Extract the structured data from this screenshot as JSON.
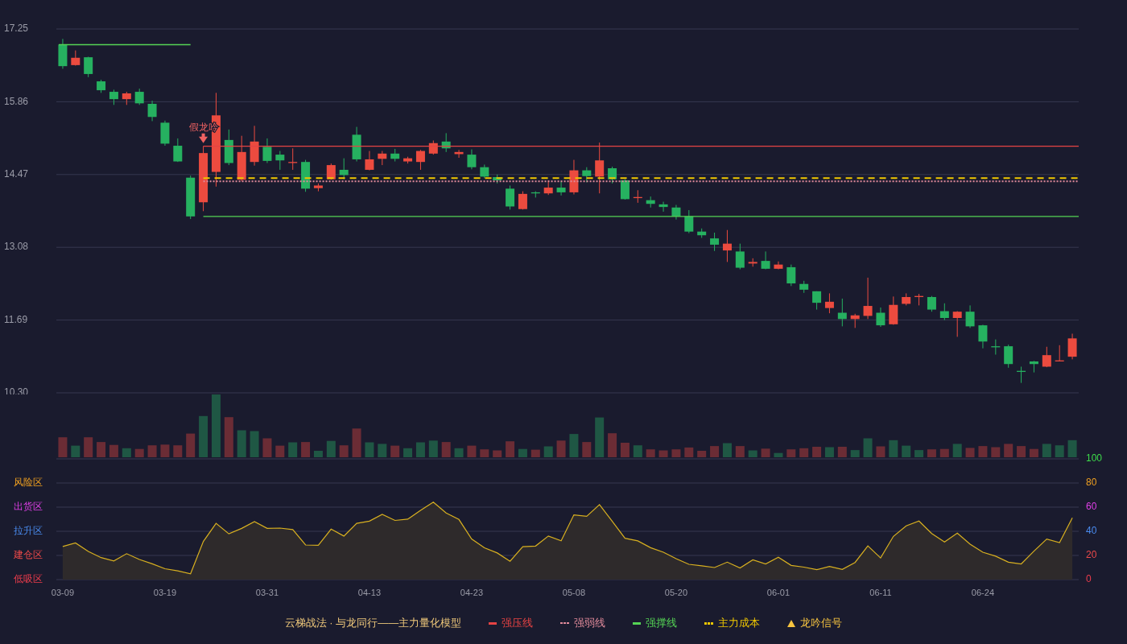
{
  "price_chart": {
    "chart_data": {
      "type": "candlestick",
      "categories": [
        null,
        null,
        null,
        null,
        null,
        null,
        null,
        null,
        null,
        null,
        null,
        null,
        null,
        null,
        null,
        null,
        null,
        null,
        null,
        null,
        null,
        null,
        null,
        null,
        null,
        null,
        null,
        null,
        null,
        null,
        null,
        null,
        null,
        null,
        null,
        null,
        null,
        null,
        null,
        null,
        null,
        null,
        null,
        null,
        null,
        null,
        null,
        null,
        null,
        null,
        null,
        null,
        null,
        null,
        null,
        null,
        null,
        null,
        null,
        null,
        null,
        null,
        null,
        null,
        null,
        null,
        null,
        null,
        null,
        null,
        null,
        null,
        null,
        null,
        null,
        null,
        null,
        null,
        null,
        null
      ],
      "ylim": [
        10.3,
        17.25
      ],
      "yticks": [
        17.25,
        15.86,
        14.47,
        13.08,
        11.69,
        {
          "value": 10.3,
          "label": "10.30"
        }
      ],
      "grid": true,
      "ohlc": [
        [
          16.95,
          17.06,
          16.49,
          16.54
        ],
        [
          16.56,
          16.84,
          16.55,
          16.7
        ],
        [
          16.71,
          16.72,
          16.33,
          16.39
        ],
        [
          16.25,
          16.28,
          16.03,
          16.08
        ],
        [
          16.05,
          16.09,
          15.8,
          15.91
        ],
        [
          15.91,
          16.05,
          15.8,
          16.02
        ],
        [
          16.05,
          16.11,
          15.8,
          15.83
        ],
        [
          15.82,
          15.88,
          15.49,
          15.57
        ],
        [
          15.46,
          15.5,
          15.02,
          15.06
        ],
        [
          15.02,
          15.16,
          14.71,
          14.72
        ],
        [
          14.41,
          14.45,
          13.62,
          13.67
        ],
        [
          13.94,
          15.01,
          13.77,
          14.88
        ],
        [
          14.52,
          16.03,
          14.24,
          15.6
        ],
        [
          15.13,
          15.33,
          14.65,
          14.69
        ],
        [
          14.37,
          15.21,
          14.34,
          14.9
        ],
        [
          14.71,
          15.4,
          14.64,
          15.1
        ],
        [
          15.0,
          15.16,
          14.69,
          14.73
        ],
        [
          14.85,
          14.92,
          14.56,
          14.74
        ],
        [
          14.69,
          14.97,
          14.56,
          14.71
        ],
        [
          14.71,
          14.75,
          14.14,
          14.2
        ],
        [
          14.21,
          14.3,
          14.15,
          14.26
        ],
        [
          14.38,
          14.68,
          14.37,
          14.65
        ],
        [
          14.56,
          14.78,
          14.38,
          14.46
        ],
        [
          15.23,
          15.38,
          14.72,
          14.76
        ],
        [
          14.56,
          14.92,
          14.55,
          14.76
        ],
        [
          14.77,
          14.92,
          14.65,
          14.87
        ],
        [
          14.87,
          14.96,
          14.72,
          14.77
        ],
        [
          14.72,
          14.81,
          14.68,
          14.78
        ],
        [
          14.71,
          14.94,
          14.56,
          14.92
        ],
        [
          14.87,
          15.12,
          14.85,
          15.07
        ],
        [
          15.1,
          15.26,
          14.9,
          14.97
        ],
        [
          14.86,
          14.94,
          14.79,
          14.9
        ],
        [
          14.85,
          14.95,
          14.57,
          14.61
        ],
        [
          14.61,
          14.66,
          14.4,
          14.43
        ],
        [
          14.42,
          14.47,
          14.3,
          14.36
        ],
        [
          14.2,
          14.26,
          13.8,
          13.86
        ],
        [
          13.81,
          14.15,
          13.8,
          14.1
        ],
        [
          14.13,
          14.15,
          14.03,
          14.11
        ],
        [
          14.11,
          14.36,
          14.08,
          14.22
        ],
        [
          14.22,
          14.35,
          14.07,
          14.13
        ],
        [
          14.13,
          14.75,
          14.09,
          14.55
        ],
        [
          14.55,
          14.61,
          14.32,
          14.44
        ],
        [
          14.43,
          15.08,
          14.11,
          14.74
        ],
        [
          14.59,
          14.62,
          14.3,
          14.38
        ],
        [
          14.36,
          14.38,
          13.99,
          14.0
        ],
        [
          14.02,
          14.17,
          13.93,
          14.04
        ],
        [
          13.98,
          14.05,
          13.84,
          13.91
        ],
        [
          13.9,
          13.95,
          13.76,
          13.85
        ],
        [
          13.84,
          13.89,
          13.61,
          13.67
        ],
        [
          13.67,
          13.79,
          13.35,
          13.38
        ],
        [
          13.38,
          13.44,
          13.26,
          13.31
        ],
        [
          13.25,
          13.36,
          13.01,
          13.13
        ],
        [
          13.02,
          13.41,
          12.8,
          13.15
        ],
        [
          13.0,
          13.15,
          12.66,
          12.69
        ],
        [
          12.77,
          12.87,
          12.71,
          12.8
        ],
        [
          12.82,
          13.0,
          12.66,
          12.67
        ],
        [
          12.67,
          12.81,
          12.66,
          12.75
        ],
        [
          12.7,
          12.75,
          12.34,
          12.39
        ],
        [
          12.38,
          12.44,
          12.21,
          12.27
        ],
        [
          12.24,
          12.24,
          11.89,
          12.02
        ],
        [
          11.92,
          12.2,
          11.82,
          12.04
        ],
        [
          11.83,
          12.1,
          11.57,
          11.71
        ],
        [
          11.71,
          11.81,
          11.54,
          11.78
        ],
        [
          11.77,
          12.5,
          11.71,
          11.96
        ],
        [
          11.83,
          11.93,
          11.56,
          11.59
        ],
        [
          11.61,
          12.14,
          11.6,
          11.98
        ],
        [
          12.0,
          12.2,
          11.97,
          12.13
        ],
        [
          12.13,
          12.19,
          11.97,
          12.15
        ],
        [
          12.13,
          12.15,
          11.85,
          11.89
        ],
        [
          11.86,
          12.01,
          11.69,
          11.73
        ],
        [
          11.73,
          11.86,
          11.37,
          11.85
        ],
        [
          11.85,
          11.97,
          11.54,
          11.57
        ],
        [
          11.59,
          11.6,
          11.15,
          11.28
        ],
        [
          11.19,
          11.32,
          11.03,
          11.17
        ],
        [
          11.19,
          11.22,
          10.78,
          10.85
        ],
        [
          10.72,
          10.8,
          10.49,
          10.7
        ],
        [
          10.9,
          10.91,
          10.69,
          10.85
        ],
        [
          10.8,
          11.18,
          10.79,
          11.02
        ],
        [
          10.9,
          11.21,
          10.9,
          10.92
        ],
        [
          10.99,
          11.43,
          10.94,
          11.34
        ]
      ],
      "ref_lines": [
        {
          "axis": "y",
          "value": 15.01,
          "label": "强压线",
          "color": "#e64343",
          "line_style": "solid"
        },
        {
          "axis": "y",
          "value": 14.34,
          "label": "强弱线",
          "color": "#e08a9a",
          "line_style": "dotted"
        },
        {
          "axis": "y",
          "value": 13.67,
          "label": "强撑线",
          "color": "#55d455",
          "line_style": "solid"
        },
        {
          "axis": "y",
          "value": 14.4,
          "label": "主力成本",
          "color": "#f0c800",
          "line_style": "dashed"
        },
        {
          "axis": "y",
          "value": 16.95,
          "color": "#55d455",
          "line_style": "solid"
        }
      ],
      "annotations": [
        "假龙吟"
      ]
    }
  },
  "oscillator": {
    "zones": [
      {
        "label": "风险区",
        "color": "#f0a020"
      },
      {
        "label": "出货区",
        "color": "#e040e8"
      },
      {
        "label": "拉升区",
        "color": "#4a8cf0"
      },
      {
        "label": "建仓区",
        "color": "#ee4a4a"
      },
      {
        "label": "低吸区",
        "color": "#ee3c4c"
      }
    ],
    "chart_data": {
      "type": "area",
      "categories": [
        "03-09",
        null,
        null,
        null,
        null,
        null,
        null,
        null,
        "03-19",
        null,
        null,
        null,
        null,
        null,
        null,
        null,
        "03-31",
        null,
        null,
        null,
        null,
        null,
        null,
        null,
        "04-13",
        null,
        null,
        null,
        null,
        null,
        null,
        null,
        "04-23",
        null,
        null,
        null,
        null,
        null,
        null,
        null,
        "05-08",
        null,
        null,
        null,
        null,
        null,
        null,
        null,
        "05-20",
        null,
        null,
        null,
        null,
        null,
        null,
        null,
        "06-01",
        null,
        null,
        null,
        null,
        null,
        null,
        null,
        "06-11",
        null,
        null,
        null,
        null,
        null,
        null,
        null,
        "06-24",
        null,
        null,
        null,
        null,
        null,
        null,
        null
      ],
      "ylim": [
        0,
        100
      ],
      "yticks": [
        100,
        80,
        60,
        40,
        20,
        0
      ],
      "grid": true,
      "series": [
        {
          "color": "#d8b020",
          "values": [
            27.5,
            30.4,
            23.3,
            18.2,
            15.5,
            21.5,
            16.7,
            13.1,
            9.0,
            7.2,
            4.8,
            31.6,
            46.6,
            37.9,
            42.4,
            48.1,
            42.4,
            42.7,
            41.5,
            28.7,
            28.4,
            41.8,
            36.1,
            46.6,
            48.4,
            54.0,
            49.0,
            50.1,
            57.3,
            64.2,
            55.2,
            49.8,
            33.7,
            26.3,
            22.1,
            15.2,
            27.2,
            27.8,
            36.1,
            32.2,
            53.6,
            52.4,
            62.1,
            48.2,
            34.2,
            32.1,
            26.4,
            22.7,
            17.3,
            12.7,
            11.5,
            10.0,
            14.5,
            9.7,
            16.4,
            13.0,
            18.5,
            11.8,
            10.3,
            8.2,
            10.9,
            8.5,
            14.2,
            27.9,
            17.9,
            35.8,
            44.5,
            48.5,
            38.2,
            31.2,
            38.5,
            29.4,
            22.7,
            19.4,
            14.5,
            13.0,
            23.6,
            33.6,
            30.6,
            51.2
          ]
        }
      ]
    }
  },
  "legend": {
    "title": "云梯战法 · 与龙同行——主力量化模型",
    "marker": {
      "label": "龙吟信号",
      "color": "#f7c440"
    }
  }
}
